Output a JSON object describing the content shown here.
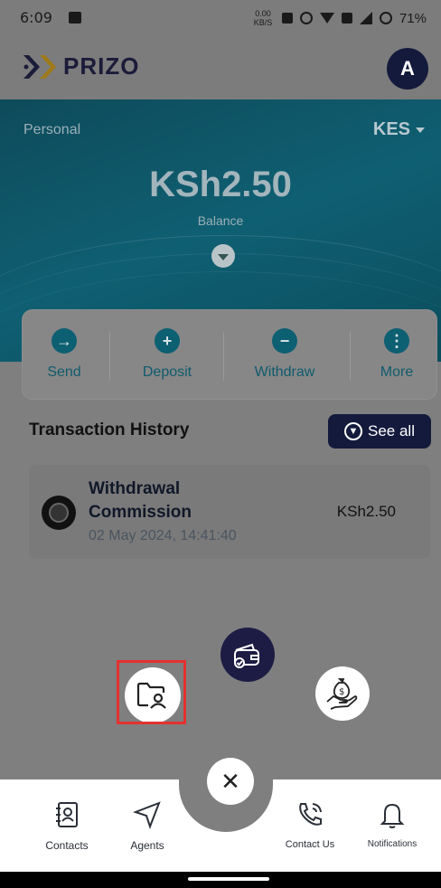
{
  "status_bar": {
    "time": "6:09",
    "net_speed": "0.00 KB/S",
    "battery": "71%"
  },
  "app": {
    "brand": "PRIZO",
    "avatar_initial": "A",
    "brand_color": "#141a3c",
    "accent_color": "#0f5f72"
  },
  "balance_card": {
    "account_type": "Personal",
    "currency": "KES",
    "balance": "KSh2.50",
    "balance_label": "Balance"
  },
  "actions": [
    {
      "label": "Send",
      "icon": "arrow-right-icon"
    },
    {
      "label": "Deposit",
      "icon": "plus-icon"
    },
    {
      "label": "Withdraw",
      "icon": "minus-icon"
    },
    {
      "label": "More",
      "icon": "more-vertical-icon"
    }
  ],
  "transactions": {
    "title": "Transaction History",
    "see_all": "See all",
    "items": [
      {
        "name": "Withdrawal Commission",
        "date": "02 May 2024, 14:41:40",
        "amount": "KSh2.50",
        "icon": "coin-icon"
      }
    ]
  },
  "fab_menu": {
    "items": [
      "wallet-icon",
      "contacts-folder-icon",
      "money-hand-icon"
    ],
    "close_icon": "close-icon"
  },
  "bottom_nav": [
    {
      "label": "Contacts",
      "icon": "contacts-book-icon"
    },
    {
      "label": "Agents",
      "icon": "send-arrow-icon"
    },
    {
      "label": "Contact Us",
      "icon": "phone-call-icon"
    },
    {
      "label": "Notifications",
      "icon": "bell-icon"
    }
  ]
}
